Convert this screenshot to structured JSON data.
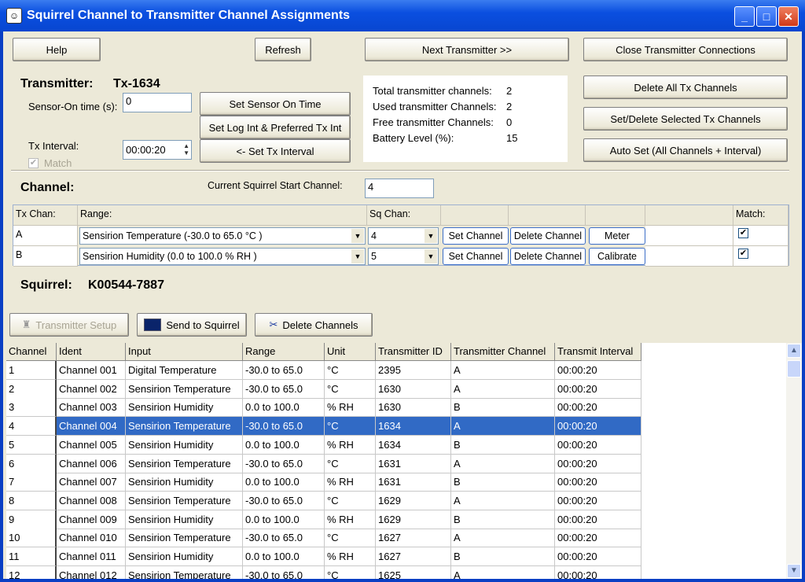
{
  "window": {
    "title": "Squirrel Channel to Transmitter Channel Assignments",
    "minimize": "_",
    "maximize": "□",
    "close": "✕"
  },
  "toolbar": {
    "help": "Help",
    "refresh": "Refresh",
    "next": "Next Transmitter >>",
    "close_conn": "Close Transmitter Connections"
  },
  "transmitter": {
    "label": "Transmitter:",
    "value": "Tx-1634",
    "sensor_on_label": "Sensor-On  time (s):",
    "sensor_on_value": "0",
    "tx_interval_label": "Tx Interval:",
    "tx_interval_value": "00:00:20",
    "match_label": "Match",
    "match_checked": true,
    "set_sensor": "Set Sensor On Time",
    "set_log": "Set Log Int & Preferred Tx Int",
    "set_tx": "<- Set Tx Interval"
  },
  "stats": [
    {
      "label": "Total transmitter channels:",
      "value": "2"
    },
    {
      "label": "Used transmitter Channels:",
      "value": "2"
    },
    {
      "label": "Free transmitter Channels:",
      "value": "0"
    },
    {
      "label": "Battery Level (%):",
      "value": "15"
    }
  ],
  "actions": {
    "delete_all": "Delete All Tx Channels",
    "set_delete": "Set/Delete Selected Tx Channels",
    "auto_set": "Auto Set (All Channels + Interval)"
  },
  "channel": {
    "label": "Channel:",
    "start_label": "Current Squirrel Start Channel:",
    "start_value": "4",
    "headers": {
      "tx": "Tx Chan:",
      "range": "Range:",
      "sq": "Sq Chan:",
      "match": "Match:"
    },
    "rows": [
      {
        "tx": "A",
        "range": "Sensirion Temperature (-30.0 to 65.0 °C   )",
        "sq": "4",
        "set": "Set Channel",
        "del": "Delete Channel",
        "extra": "Meter",
        "match": true
      },
      {
        "tx": "B",
        "range": "Sensirion Humidity (0.0 to 100.0 % RH  )",
        "sq": "5",
        "set": "Set Channel",
        "del": "Delete Channel",
        "extra": "Calibrate",
        "match": true
      }
    ]
  },
  "squirrel": {
    "label": "Squirrel:",
    "value": "K00544-7887"
  },
  "bottom_toolbar": {
    "tx_setup": "Transmitter Setup",
    "send": "Send to Squirrel",
    "delete": "Delete Channels"
  },
  "table": {
    "columns": [
      "Channel",
      "Ident",
      "Input",
      "Range",
      "Unit",
      "Transmitter ID",
      "Transmitter Channel",
      "Transmit Interval"
    ],
    "selected_row": 4,
    "rows": [
      [
        "1",
        "Channel 001",
        "Digital Temperature",
        "-30.0 to 65.0",
        "°C",
        "2395",
        "A",
        "00:00:20"
      ],
      [
        "2",
        "Channel 002",
        "Sensirion Temperature",
        "-30.0 to 65.0",
        "°C",
        "1630",
        "A",
        "00:00:20"
      ],
      [
        "3",
        "Channel 003",
        "Sensirion Humidity",
        "0.0 to 100.0",
        "% RH",
        "1630",
        "B",
        "00:00:20"
      ],
      [
        "4",
        "Channel 004",
        "Sensirion Temperature",
        "-30.0 to 65.0",
        "°C",
        "1634",
        "A",
        "00:00:20"
      ],
      [
        "5",
        "Channel 005",
        "Sensirion Humidity",
        "0.0 to 100.0",
        "% RH",
        "1634",
        "B",
        "00:00:20"
      ],
      [
        "6",
        "Channel 006",
        "Sensirion Temperature",
        "-30.0 to 65.0",
        "°C",
        "1631",
        "A",
        "00:00:20"
      ],
      [
        "7",
        "Channel 007",
        "Sensirion Humidity",
        "0.0 to 100.0",
        "% RH",
        "1631",
        "B",
        "00:00:20"
      ],
      [
        "8",
        "Channel 008",
        "Sensirion Temperature",
        "-30.0 to 65.0",
        "°C",
        "1629",
        "A",
        "00:00:20"
      ],
      [
        "9",
        "Channel 009",
        "Sensirion Humidity",
        "0.0 to 100.0",
        "% RH",
        "1629",
        "B",
        "00:00:20"
      ],
      [
        "10",
        "Channel 010",
        "Sensirion Temperature",
        "-30.0 to 65.0",
        "°C",
        "1627",
        "A",
        "00:00:20"
      ],
      [
        "11",
        "Channel 011",
        "Sensirion Humidity",
        "0.0 to 100.0",
        "% RH",
        "1627",
        "B",
        "00:00:20"
      ],
      [
        "12",
        "Channel 012",
        "Sensirion Temperature",
        "-30.0 to 65.0",
        "°C",
        "1625",
        "A",
        "00:00:20"
      ]
    ]
  },
  "colors": {
    "title_bar": "#0a4fe0",
    "selection": "#316ac5",
    "face": "#ece9d8"
  }
}
